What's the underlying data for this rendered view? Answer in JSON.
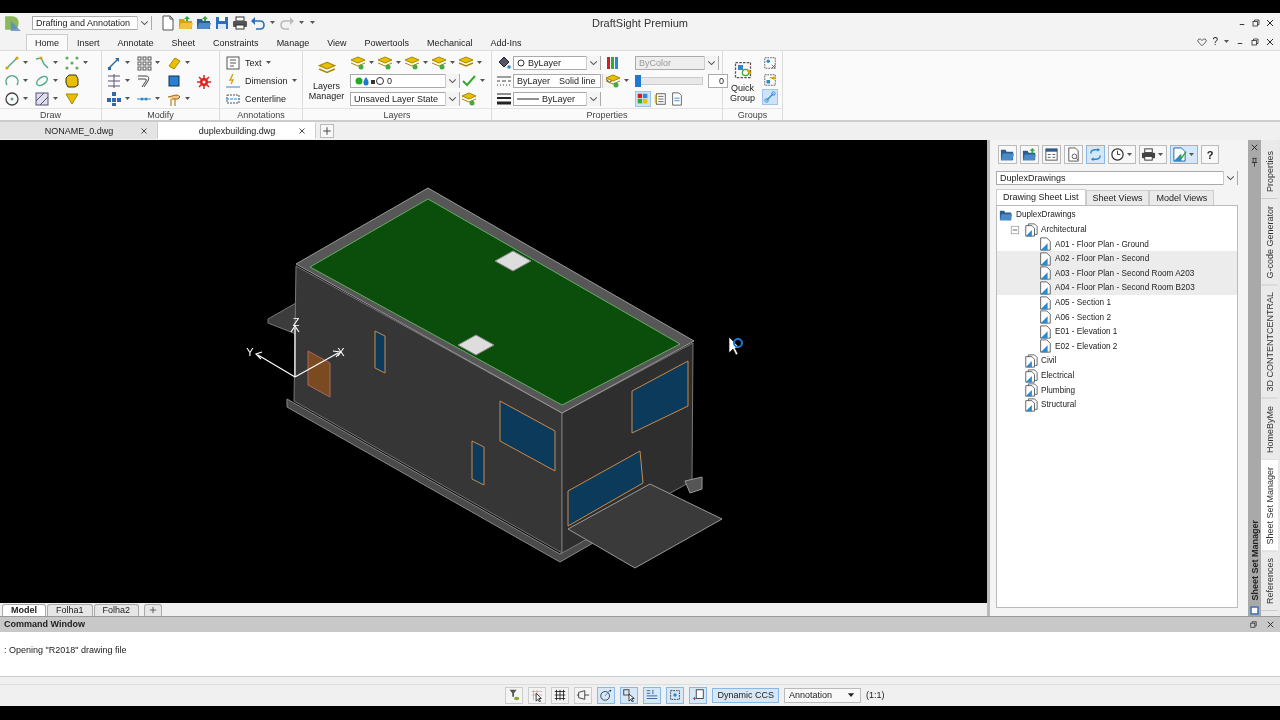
{
  "title_bar": {
    "workspace": "Drafting and Annotation",
    "title": "DraftSight Premium",
    "help": "?"
  },
  "ribbon_tabs": [
    {
      "label": "Home",
      "selected": true
    },
    {
      "label": "Insert",
      "selected": false
    },
    {
      "label": "Annotate",
      "selected": false
    },
    {
      "label": "Sheet",
      "selected": false
    },
    {
      "label": "Constraints",
      "selected": false
    },
    {
      "label": "Manage",
      "selected": false
    },
    {
      "label": "View",
      "selected": false
    },
    {
      "label": "Powertools",
      "selected": false
    },
    {
      "label": "Mechanical",
      "selected": false
    },
    {
      "label": "Add-Ins",
      "selected": false
    }
  ],
  "ribbon": {
    "draw": {
      "label": "Draw"
    },
    "modify": {
      "label": "Modify"
    },
    "annotations": {
      "label": "Annotations",
      "items": [
        "Text",
        "Dimension",
        "Centerline"
      ]
    },
    "layers": {
      "label": "Layers",
      "manager": "Layers Manager",
      "current_layer": "0",
      "layer_state": "Unsaved Layer State"
    },
    "properties": {
      "label": "Properties",
      "color_value": "ByLayer",
      "linetype_layer": "ByLayer",
      "linetype": "Solid line",
      "lineweight": "ByLayer",
      "plot_color": "ByColor",
      "plot_color_disabled": true,
      "transparency": {
        "level": 0,
        "value": "0"
      },
      "toggles": [
        {
          "on": true
        },
        {
          "on": false
        },
        {
          "on": false
        }
      ]
    },
    "groups": {
      "label": "Groups",
      "quick_group": "Quick Group",
      "toggles": [
        {
          "on": false
        },
        {
          "on": false
        },
        {
          "on": true
        }
      ]
    }
  },
  "document_tabs": [
    {
      "label": "NONAME_0.dwg",
      "selected": false
    },
    {
      "label": "duplexbuilding.dwg",
      "selected": true
    }
  ],
  "viewport": {
    "axis": {
      "x": "X",
      "y": "Y",
      "z": "Z"
    }
  },
  "layout_tabs": [
    {
      "label": "Model",
      "selected": true
    },
    {
      "label": "Folha1",
      "selected": false
    },
    {
      "label": "Folha2",
      "selected": false
    }
  ],
  "sheet_set_manager": {
    "title": "Sheet Set Manager",
    "help": "?",
    "toolbar": [
      {
        "kind": "open",
        "on": false
      },
      {
        "kind": "upload",
        "on": false
      },
      {
        "kind": "list",
        "on": false
      },
      {
        "kind": "preview",
        "on": false
      },
      {
        "kind": "sync",
        "on": true
      },
      {
        "kind": "clock",
        "on": false
      },
      {
        "kind": "print",
        "on": false
      },
      {
        "kind": "publish",
        "on": true
      }
    ],
    "sheet_set": "DuplexDrawings",
    "tabs": [
      {
        "label": "Drawing Sheet List",
        "selected": true
      },
      {
        "label": "Sheet Views",
        "selected": false
      },
      {
        "label": "Model Views",
        "selected": false
      }
    ],
    "tree": [
      {
        "label": "DuplexDrawings",
        "kind": "set",
        "selected": false,
        "children": [
          {
            "label": "Architectural",
            "kind": "subset",
            "selected": false,
            "children": [
              {
                "label": "A01 - Floor Plan - Ground",
                "kind": "sheet",
                "selected": false
              },
              {
                "label": "A02 - Floor Plan - Second",
                "kind": "sheet",
                "selected": true
              },
              {
                "label": "A03 - Floor Plan - Second Room A203",
                "kind": "sheet",
                "selected": true
              },
              {
                "label": "A04 - Floor Plan - Second Room B203",
                "kind": "sheet",
                "selected": true
              },
              {
                "label": "A05 - Section 1",
                "kind": "sheet",
                "selected": false
              },
              {
                "label": "A06 - Section 2",
                "kind": "sheet",
                "selected": false
              },
              {
                "label": "E01 - Elevation 1",
                "kind": "sheet",
                "selected": false
              },
              {
                "label": "E02 - Elevation 2",
                "kind": "sheet",
                "selected": false
              }
            ]
          },
          {
            "label": "Civil",
            "kind": "subset",
            "selected": false
          },
          {
            "label": "Electrical",
            "kind": "subset",
            "selected": false
          },
          {
            "label": "Plumbing",
            "kind": "subset",
            "selected": false
          },
          {
            "label": "Structural",
            "kind": "subset",
            "selected": false
          }
        ]
      }
    ]
  },
  "side_tabs": [
    {
      "label": "Properties",
      "selected": false
    },
    {
      "label": "G-code Generator",
      "selected": false
    },
    {
      "label": "3D CONTENTCENTRAL",
      "selected": false
    },
    {
      "label": "HomeByMe",
      "selected": false
    },
    {
      "label": "Sheet Set Manager",
      "selected": true
    },
    {
      "label": "References",
      "selected": false
    }
  ],
  "command_window": {
    "title": "Command Window",
    "lines": [
      ": Opening \"R2018\" drawing file"
    ]
  },
  "status_bar": {
    "toggles": [
      {
        "kind": "filter",
        "on": false
      },
      {
        "kind": "select",
        "on": false
      },
      {
        "kind": "grid",
        "on": false
      },
      {
        "kind": "ortho",
        "on": false
      },
      {
        "kind": "polar",
        "on": true
      },
      {
        "kind": "esnap",
        "on": true
      },
      {
        "kind": "etrack",
        "on": true
      },
      {
        "kind": "weight",
        "on": true
      },
      {
        "kind": "input",
        "on": true
      }
    ],
    "dynamic_ccs": {
      "label": "Dynamic CCS",
      "on": true
    },
    "annotation_scale": "Annotation",
    "scale": "(1:1)"
  }
}
